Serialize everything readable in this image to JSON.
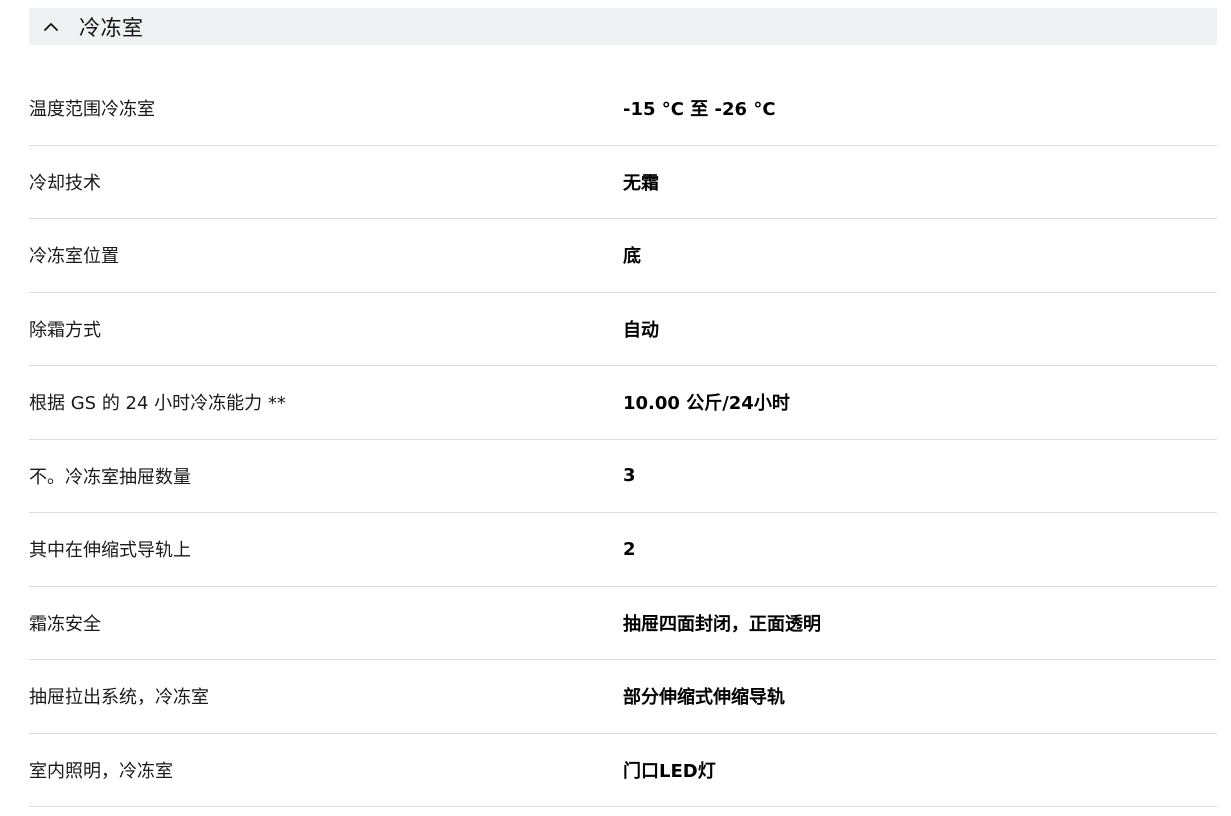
{
  "section": {
    "title": "冷冻室",
    "expanded": true,
    "toggle_icon": "chevron-up-icon"
  },
  "specs": [
    {
      "label": "温度范围冷冻室",
      "value": "-15 °C 至 -26 °C"
    },
    {
      "label": "冷却技术",
      "value": "无霜"
    },
    {
      "label": "冷冻室位置",
      "value": "底"
    },
    {
      "label": "除霜方式",
      "value": "自动"
    },
    {
      "label": "根据 GS 的 24 小时冷冻能力 **",
      "value": "10.00 公斤/24小时"
    },
    {
      "label": "不。冷冻室抽屉数量",
      "value": "3"
    },
    {
      "label": "其中在伸缩式导轨上",
      "value": "2"
    },
    {
      "label": "霜冻安全",
      "value": "抽屉四面封闭，正面透明"
    },
    {
      "label": "抽屉拉出系统，冷冻室",
      "value": "部分伸缩式伸缩导轨"
    },
    {
      "label": "室内照明，冷冻室",
      "value": "门口LED灯"
    }
  ]
}
